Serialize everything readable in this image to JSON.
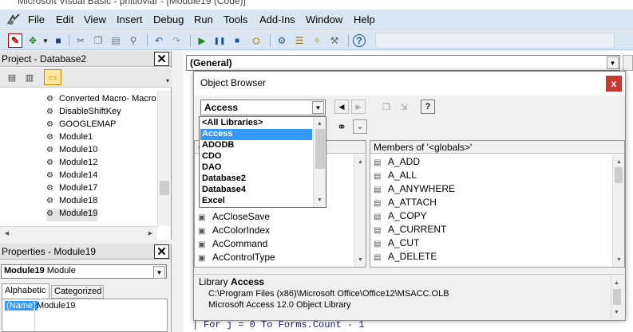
{
  "window": {
    "title": "Microsoft Visual Basic - phitiovlar - [Module19 (Code)]"
  },
  "menu": [
    "File",
    "Edit",
    "View",
    "Insert",
    "Debug",
    "Run",
    "Tools",
    "Add-Ins",
    "Window",
    "Help"
  ],
  "toolbar_icons": [
    "access-icon",
    "insert-icon",
    "save-icon",
    "cut-icon",
    "copy-icon",
    "paste-icon",
    "find-icon",
    "undo-icon",
    "redo-icon",
    "run-icon",
    "break-icon",
    "reset-icon",
    "design-mode-icon",
    "project-explorer-icon",
    "properties-icon",
    "object-browser-icon",
    "toolbox-icon",
    "help-icon"
  ],
  "project": {
    "title": "Project - Database2",
    "items": [
      "Converted Macro- Macro",
      "DisableShiftKey",
      "GOOGLEMAP",
      "Module1",
      "Module10",
      "Module12",
      "Module14",
      "Module17",
      "Module18",
      "Module19"
    ]
  },
  "properties": {
    "title": "Properties - Module19",
    "object_name": "Module19",
    "object_type": "Module",
    "tabs": [
      "Alphabetic",
      "Categorized"
    ],
    "row_name": "(Name)",
    "row_value": "Module19"
  },
  "code": {
    "object_combo": "(General)",
    "line": "For j = 0 To Forms.Count - 1"
  },
  "object_browser": {
    "title": "Object Browser",
    "close_glyph": "x",
    "library_combo": "Access",
    "library_options": [
      "<All Libraries>",
      "Access",
      "ADODB",
      "CDO",
      "DAO",
      "Database2",
      "Database4",
      "Excel"
    ],
    "selected_option": "Access",
    "classes_header_initial": "C",
    "classes": [
      "AcCloseSave",
      "AcColorIndex",
      "AcCommand",
      "AcControlType"
    ],
    "members_header": "Members of '<globals>'",
    "members": [
      "A_ADD",
      "A_ALL",
      "A_ANYWHERE",
      "A_ATTACH",
      "A_COPY",
      "A_CURRENT",
      "A_CUT",
      "A_DELETE"
    ],
    "details": {
      "label": "Library",
      "library_name": "Access",
      "path": "C:\\Program Files (x86)\\Microsoft Office\\Office12\\MSACC.OLB",
      "description": "Microsoft Access 12.0 Object Library"
    }
  },
  "colors": {
    "menubar": "#d9e7f5",
    "selection": "#3399ff",
    "close": "#c7392f"
  }
}
